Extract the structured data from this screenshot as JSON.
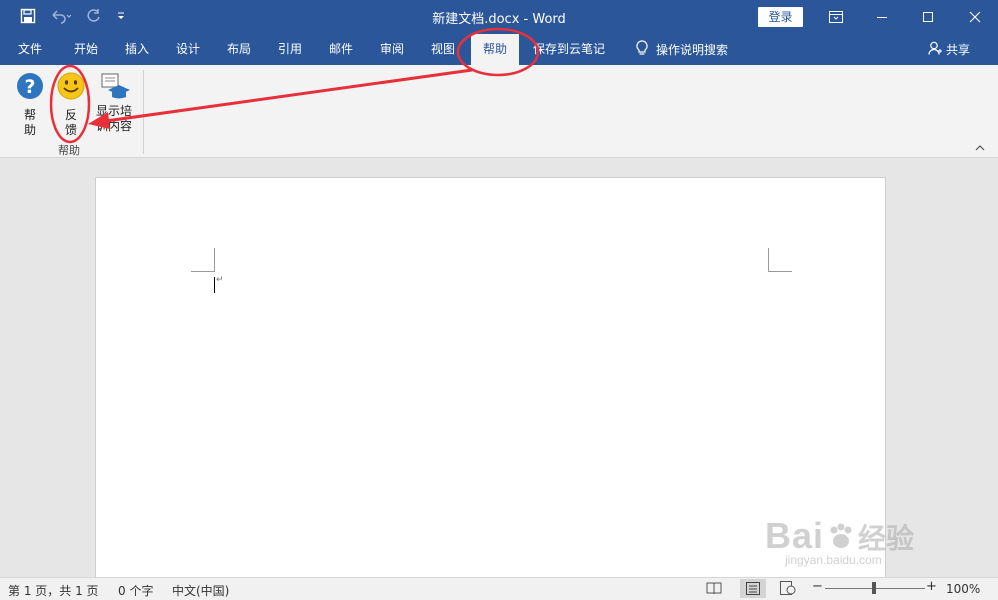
{
  "window": {
    "title": "新建文档.docx  -  Word",
    "login_label": "登录"
  },
  "tabs": [
    {
      "label": "文件"
    },
    {
      "label": "开始"
    },
    {
      "label": "插入"
    },
    {
      "label": "设计"
    },
    {
      "label": "布局"
    },
    {
      "label": "引用"
    },
    {
      "label": "邮件"
    },
    {
      "label": "审阅"
    },
    {
      "label": "视图"
    },
    {
      "label": "帮助",
      "active": true
    },
    {
      "label": "保存到云笔记"
    }
  ],
  "tell_me": {
    "label": "操作说明搜索",
    "icon": "lightbulb-icon"
  },
  "share": {
    "label": "共享",
    "icon": "person-icon"
  },
  "ribbon": {
    "group_label": "帮助",
    "buttons": {
      "help": {
        "line1": "帮",
        "line2": "助",
        "icon": "question-icon"
      },
      "feedback": {
        "line1": "反",
        "line2": "馈",
        "icon": "smiley-icon"
      },
      "training": {
        "line1": "显示培",
        "line2": "训内容",
        "icon": "graduation-cap-icon"
      }
    }
  },
  "statusbar": {
    "page": "第 1 页，共 1 页",
    "words": "0 个字",
    "language": "中文(中国)",
    "zoom": "100%",
    "zoom_level": 100
  },
  "watermark": {
    "text": "Bai",
    "text2": "经验",
    "sub": "jingyan.baidu.com"
  },
  "colors": {
    "brand": "#2b579a",
    "annotation": "#e8303a",
    "help_icon": "#2e75c0",
    "smiley": "#f5c518"
  }
}
